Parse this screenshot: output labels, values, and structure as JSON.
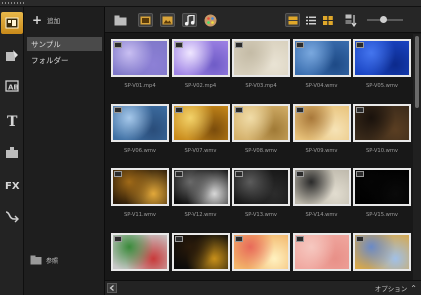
{
  "panel": {
    "add_label": "追加",
    "folders": [
      {
        "label": "サンプル",
        "selected": true
      },
      {
        "label": "フォルダー",
        "selected": false
      }
    ],
    "browse_label": "参照"
  },
  "rail": {
    "items": [
      {
        "name": "media-library-icon",
        "active": true
      },
      {
        "name": "instant-project-icon",
        "active": false
      },
      {
        "name": "text-title-icon",
        "active": false
      },
      {
        "name": "title-icon",
        "active": false
      },
      {
        "name": "transition-icon",
        "active": false
      },
      {
        "name": "fx-filter-icon",
        "active": false
      },
      {
        "name": "path-motion-icon",
        "active": false
      }
    ]
  },
  "toolbar": {
    "buttons": [
      "folder-icon",
      "video-filter-icon",
      "photo-filter-icon",
      "audio-filter-icon",
      "color-filter-icon"
    ],
    "views": [
      "thumbnail-view-icon",
      "list-view-icon",
      "detail-view-icon"
    ],
    "sort": "sort-icon"
  },
  "clips": [
    {
      "label": "SP-V01.mp4",
      "colors": [
        "#7e77c8",
        "#c9bff2",
        "#8d80d6"
      ]
    },
    {
      "label": "SP-V02.mp4",
      "colors": [
        "#9f84e6",
        "#efe6ff",
        "#6f5cc7"
      ]
    },
    {
      "label": "SP-V03.mp4",
      "colors": [
        "#d8d0bd",
        "#c4bba6",
        "#e9e3d4"
      ]
    },
    {
      "label": "SP-V04.wmv",
      "colors": [
        "#3b6fb0",
        "#7aa8de",
        "#1e4a86"
      ]
    },
    {
      "label": "SP-V05.wmv",
      "colors": [
        "#1a45c4",
        "#4475ee",
        "#0c2a8c"
      ]
    },
    {
      "label": "SP-V06.wmv",
      "colors": [
        "#3e6fa3",
        "#a6c8ea",
        "#2a4d7a"
      ]
    },
    {
      "label": "SP-V07.wmv",
      "colors": [
        "#c98a1a",
        "#f2d26a",
        "#7a4c0c"
      ]
    },
    {
      "label": "SP-V08.wmv",
      "colors": [
        "#d4b06a",
        "#f0dca8",
        "#a07a36"
      ]
    },
    {
      "label": "SP-V09.wmv",
      "colors": [
        "#e8c27a",
        "#a8783a",
        "#f6e3b6"
      ]
    },
    {
      "label": "SP-V10.wmv",
      "colors": [
        "#3a2a1a",
        "#1a120c",
        "#5a3e22"
      ]
    },
    {
      "label": "SP-V11.wmv",
      "colors": [
        "#2a1a08",
        "#a06a18",
        "#e2a83a"
      ]
    },
    {
      "label": "SP-V12.wmv",
      "colors": [
        "#0e0e0e",
        "#6a6a6a",
        "#d8d8d8"
      ]
    },
    {
      "label": "SP-V13.wmv",
      "colors": [
        "#151515",
        "#5c5c5c",
        "#2c2c2c"
      ]
    },
    {
      "label": "SP-V14.wmv",
      "colors": [
        "#bdb8ab",
        "#2a2a2a",
        "#e2ddd0"
      ]
    },
    {
      "label": "SP-V15.wmv",
      "colors": [
        "#000000",
        "#050505",
        "#0a0a0a"
      ]
    },
    {
      "label": "",
      "colors": [
        "#c8c8c8",
        "#3a8a3a",
        "#c83a3a"
      ]
    },
    {
      "label": "",
      "colors": [
        "#0a0a0a",
        "#2a1a0a",
        "#c8901a"
      ]
    },
    {
      "label": "",
      "colors": [
        "#f2b66a",
        "#e86a5a",
        "#fff1c0"
      ]
    },
    {
      "label": "",
      "colors": [
        "#f0a8a0",
        "#f6c8c0",
        "#e89088"
      ]
    },
    {
      "label": "",
      "colors": [
        "#d8a84a",
        "#6a8ac8",
        "#a0c0e8"
      ]
    }
  ],
  "bottom": {
    "options_label": "オプション"
  }
}
